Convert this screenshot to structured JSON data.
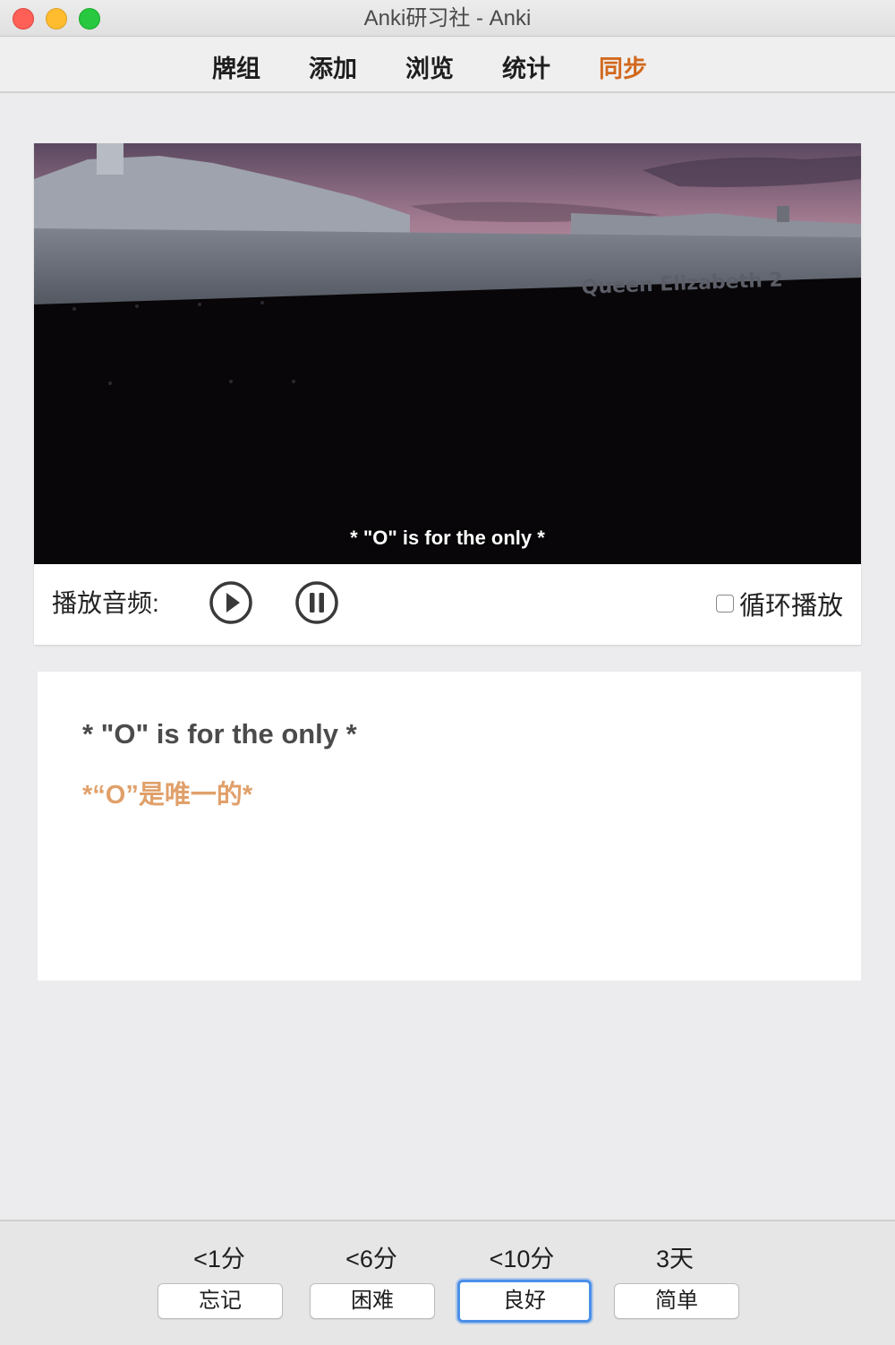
{
  "window": {
    "title": "Anki研习社 - Anki"
  },
  "toolbar": {
    "items": [
      {
        "label": "牌组"
      },
      {
        "label": "添加"
      },
      {
        "label": "浏览"
      },
      {
        "label": "统计"
      },
      {
        "label": "同步"
      }
    ]
  },
  "media": {
    "subtitle": "* \"O\" is for the only *",
    "ship_lettering": "Queen Elizabeth 2",
    "audio_label": "播放音频:",
    "loop_label": "循环播放",
    "loop_checked": false
  },
  "card": {
    "front_text": "* \"O\" is for the only *",
    "back_text": "*“O”是唯一的*",
    "back_color": "#e0a06a"
  },
  "answers": [
    {
      "interval": "<1分",
      "label": "忘记"
    },
    {
      "interval": "<6分",
      "label": "困难"
    },
    {
      "interval": "<10分",
      "label": "良好",
      "focused": true
    },
    {
      "interval": "3天",
      "label": "简单"
    }
  ],
  "colors": {
    "sync_accent": "#d2691e",
    "focus_ring": "#4a8fe8"
  }
}
